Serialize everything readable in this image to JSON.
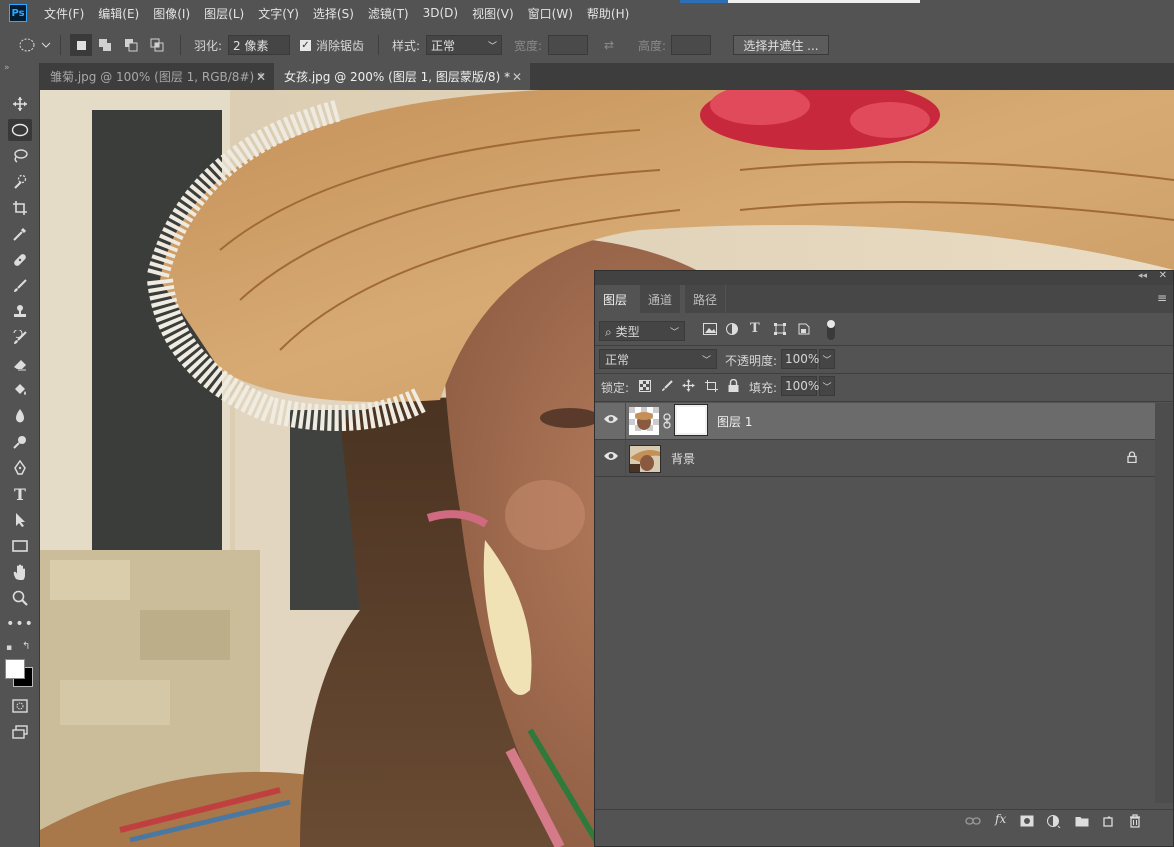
{
  "menubar": {
    "app_logo": "Ps",
    "items": [
      "文件(F)",
      "编辑(E)",
      "图像(I)",
      "图层(L)",
      "文字(Y)",
      "选择(S)",
      "滤镜(T)",
      "3D(D)",
      "视图(V)",
      "窗口(W)",
      "帮助(H)"
    ]
  },
  "options": {
    "feather_label": "羽化:",
    "feather_value": "2 像素",
    "antialias_label": "消除锯齿",
    "antialias_checked": true,
    "style_label": "样式:",
    "style_value": "正常",
    "width_label": "宽度:",
    "height_label": "高度:",
    "select_mask_button": "选择并遮住 ..."
  },
  "tabs": [
    {
      "label": "雏菊.jpg @ 100% (图层 1, RGB/8#) *",
      "active": false
    },
    {
      "label": "女孩.jpg @ 200% (图层 1, 图层蒙版/8) *",
      "active": true
    }
  ],
  "tools": [
    "move-tool-icon",
    "elliptical-marquee-tool-icon",
    "lasso-tool-icon",
    "quick-selection-tool-icon",
    "crop-tool-icon",
    "eyedropper-tool-icon",
    "healing-brush-tool-icon",
    "brush-tool-icon",
    "clone-stamp-tool-icon",
    "history-brush-tool-icon",
    "eraser-tool-icon",
    "paint-bucket-tool-icon",
    "blur-tool-icon",
    "dodge-tool-icon",
    "pen-tool-icon",
    "type-tool-icon",
    "path-selection-tool-icon",
    "rectangle-tool-icon",
    "hand-tool-icon",
    "zoom-tool-icon",
    "more-tools-icon"
  ],
  "layers_panel": {
    "tabs": [
      "图层",
      "通道",
      "路径"
    ],
    "active_tab": "图层",
    "filter_kind": "类型",
    "blend_mode": "正常",
    "opacity_label": "不透明度:",
    "opacity_value": "100%",
    "lock_label": "锁定:",
    "fill_label": "填充:",
    "fill_value": "100%",
    "layers": [
      {
        "name": "图层 1",
        "selected": true,
        "has_mask": true,
        "locked": false
      },
      {
        "name": "背景",
        "selected": false,
        "has_mask": false,
        "locked": true
      }
    ]
  },
  "colors": {
    "ui_bg": "#535353",
    "tab_bg": "#3d3d3d",
    "selected_layer": "#6b6b6b",
    "accent": "#31a8ff"
  }
}
